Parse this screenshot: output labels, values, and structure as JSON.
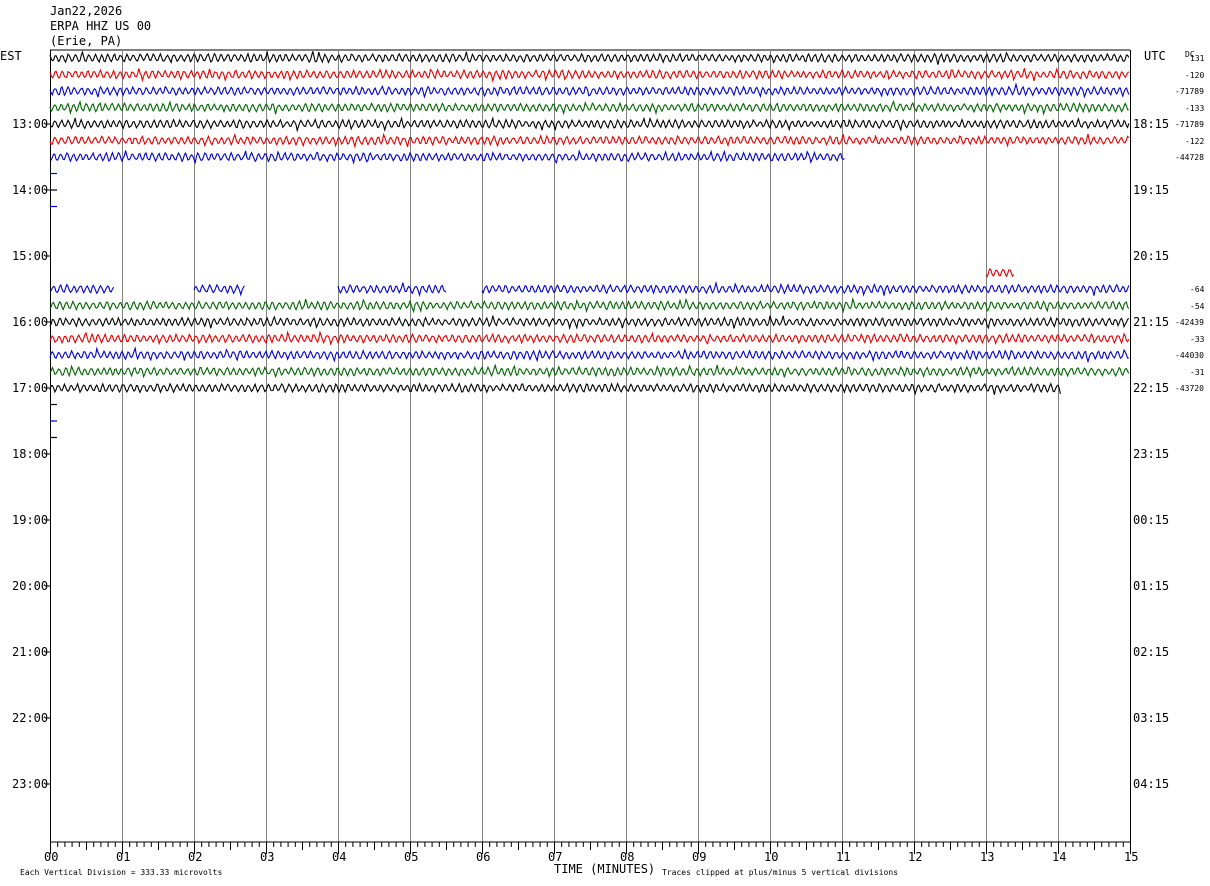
{
  "header": {
    "date": "Jan22,2026",
    "station": "ERPA HHZ US 00",
    "location": "(Erie, PA)"
  },
  "axes": {
    "left_tz": "EST",
    "right_tz": "UTC",
    "dc_label": "DC",
    "x_title": "TIME (MINUTES)",
    "left_hours": [
      "13:00",
      "14:00",
      "15:00",
      "16:00",
      "17:00",
      "18:00",
      "19:00",
      "20:00",
      "21:00",
      "22:00",
      "23:00"
    ],
    "right_hours": [
      "18:15",
      "19:15",
      "20:15",
      "21:15",
      "22:15",
      "23:15",
      "00:15",
      "01:15",
      "02:15",
      "03:15",
      "04:15"
    ],
    "x_ticks": [
      "00",
      "01",
      "02",
      "03",
      "04",
      "05",
      "06",
      "07",
      "08",
      "09",
      "10",
      "11",
      "12",
      "13",
      "14",
      "15"
    ]
  },
  "footer": {
    "scale_note": "Each Vertical Division =  333.33 microvolts",
    "clip_note": "Traces clipped at plus/minus 5 vertical divisions"
  },
  "colors": {
    "black": "#000000",
    "red": "#e00000",
    "blue": "#0000d0",
    "green": "#006400",
    "grid": "#808080"
  },
  "chart_data": {
    "type": "line",
    "title": "",
    "xlabel": "TIME (MINUTES)",
    "xlim": [
      0,
      15
    ],
    "row_minutes": 15,
    "start_row_time_est": "12:15",
    "traces": [
      {
        "row": 0,
        "color": "black",
        "dc": "131",
        "segments": [
          [
            0,
            15
          ]
        ]
      },
      {
        "row": 1,
        "color": "red",
        "dc": "-120",
        "segments": [
          [
            0,
            15
          ]
        ]
      },
      {
        "row": 2,
        "color": "blue",
        "dc": "-71789",
        "segments": [
          [
            0,
            15
          ]
        ]
      },
      {
        "row": 3,
        "color": "green",
        "dc": "-133",
        "segments": [
          [
            0,
            15
          ]
        ]
      },
      {
        "row": 4,
        "color": "black",
        "dc": "-71789",
        "segments": [
          [
            0,
            15
          ]
        ]
      },
      {
        "row": 5,
        "color": "red",
        "dc": "-122",
        "segments": [
          [
            0,
            15
          ]
        ]
      },
      {
        "row": 6,
        "color": "blue",
        "dc": "-44728",
        "segments": [
          [
            0,
            11.05
          ]
        ]
      },
      {
        "row": 13,
        "color": "red",
        "dc": "",
        "segments": [
          [
            13.0,
            13.4
          ]
        ]
      },
      {
        "row": 14,
        "color": "blue",
        "dc": "-64",
        "segments": [
          [
            0,
            0.9
          ],
          [
            2.0,
            2.7
          ],
          [
            4.0,
            5.5
          ],
          [
            6.0,
            15
          ]
        ]
      },
      {
        "row": 15,
        "color": "green",
        "dc": "-54",
        "segments": [
          [
            0,
            15
          ]
        ]
      },
      {
        "row": 16,
        "color": "black",
        "dc": "-42439",
        "segments": [
          [
            0,
            15
          ]
        ]
      },
      {
        "row": 17,
        "color": "red",
        "dc": "-33",
        "segments": [
          [
            0,
            15
          ]
        ]
      },
      {
        "row": 18,
        "color": "blue",
        "dc": "-44030",
        "segments": [
          [
            0,
            15
          ]
        ]
      },
      {
        "row": 19,
        "color": "green",
        "dc": "-31",
        "segments": [
          [
            0,
            15
          ]
        ]
      },
      {
        "row": 20,
        "color": "black",
        "dc": "-43720",
        "segments": [
          [
            0,
            14.05
          ]
        ]
      }
    ],
    "markers": [
      {
        "row": 7,
        "color": "blue"
      },
      {
        "row": 8,
        "color": "black"
      },
      {
        "row": 9,
        "color": "blue"
      },
      {
        "row": 21,
        "color": "black"
      },
      {
        "row": 22,
        "color": "blue"
      },
      {
        "row": 23,
        "color": "black"
      }
    ]
  }
}
